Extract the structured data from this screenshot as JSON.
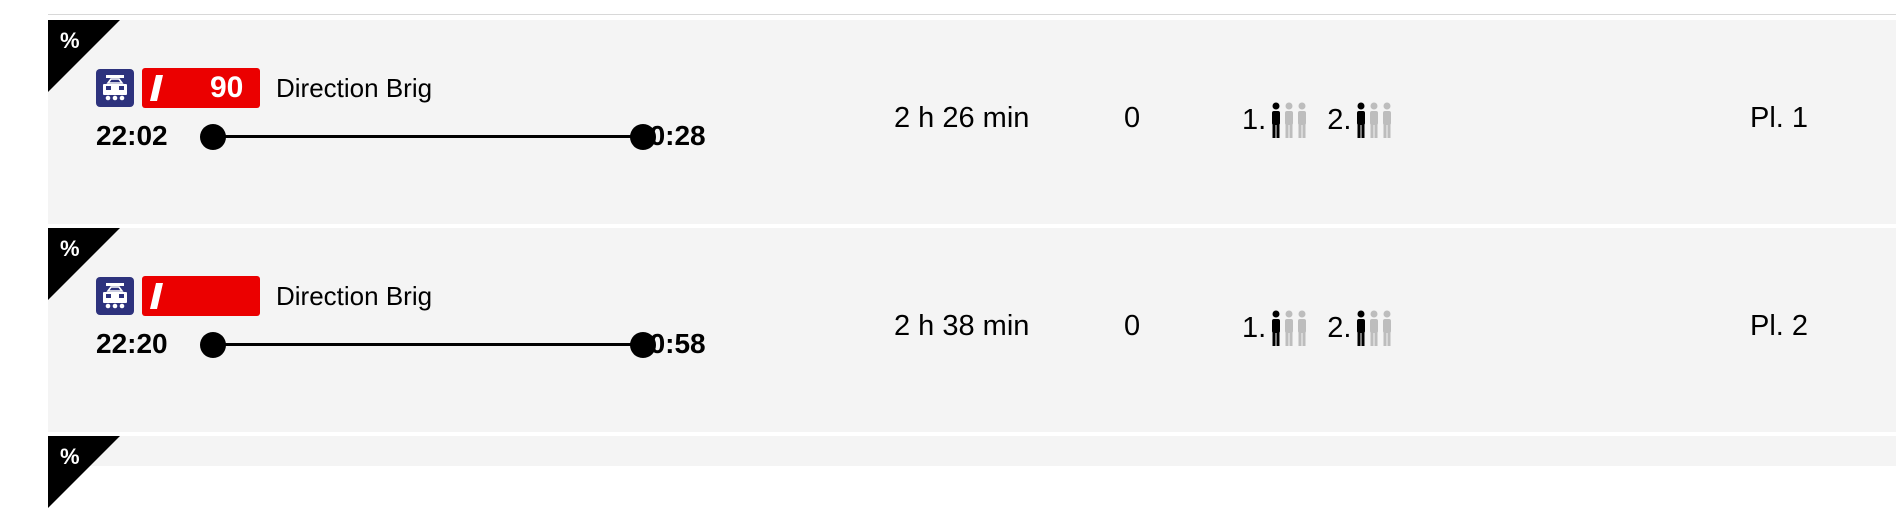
{
  "colors": {
    "row_background": "#f4f4f4",
    "ir_red": "#eb0000",
    "train_icon_blue": "#2d327d",
    "occupancy_full": "#000000",
    "occupancy_empty": "#bdbdbd"
  },
  "connections": [
    {
      "discount_badge": "%",
      "product_icon": "train-icon",
      "category_logo": "IR",
      "line_number": "90",
      "direction": "Direction Brig",
      "departure": "22:02",
      "arrival": "00:28",
      "duration": "2 h 26 min",
      "changes": "0",
      "occupancy": {
        "first_class_label": "1.",
        "first_class_level": "1 of 3",
        "second_class_label": "2.",
        "second_class_level": "1 of 3"
      },
      "platform": "Pl. 1"
    },
    {
      "discount_badge": "%",
      "product_icon": "train-icon",
      "category_logo": "IR",
      "line_number": "",
      "direction": "Direction Brig",
      "departure": "22:20",
      "arrival": "00:58",
      "duration": "2 h 38 min",
      "changes": "0",
      "occupancy": {
        "first_class_label": "1.",
        "first_class_level": "1 of 3",
        "second_class_label": "2.",
        "second_class_level": "1 of 3"
      },
      "platform": "Pl. 2"
    },
    {
      "discount_badge": "%"
    }
  ]
}
